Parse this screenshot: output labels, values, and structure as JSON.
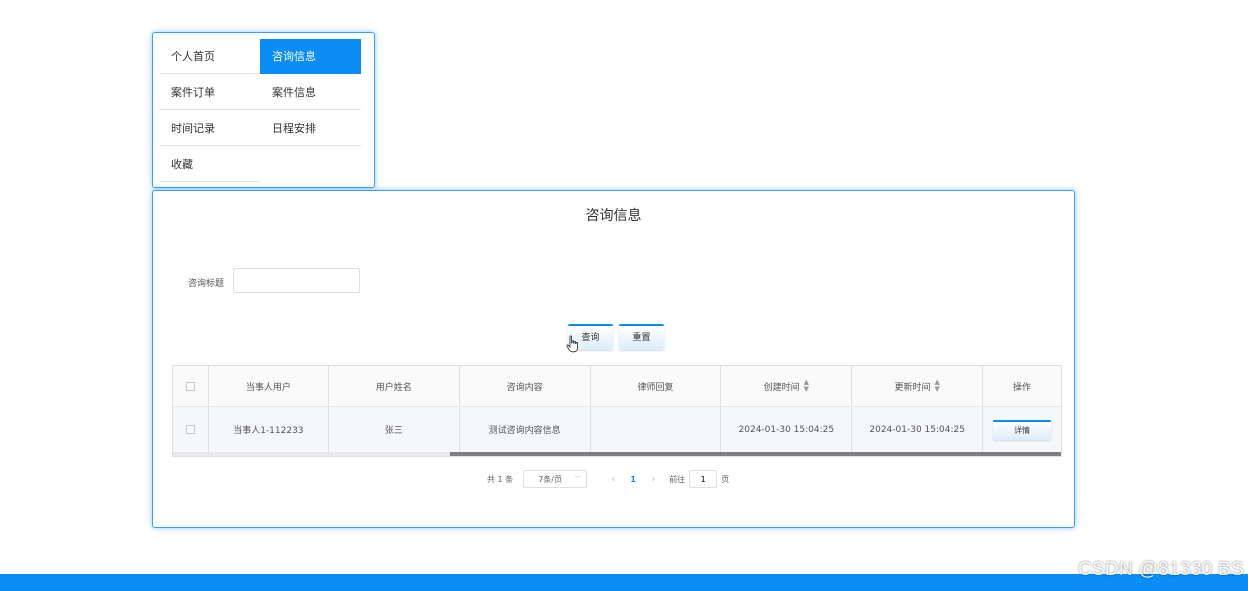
{
  "menu": {
    "items": [
      {
        "label": "个人首页",
        "active": false
      },
      {
        "label": "咨询信息",
        "active": true
      },
      {
        "label": "案件订单",
        "active": false
      },
      {
        "label": "案件信息",
        "active": false
      },
      {
        "label": "时间记录",
        "active": false
      },
      {
        "label": "日程安排",
        "active": false
      },
      {
        "label": "收藏",
        "active": false
      }
    ]
  },
  "panel": {
    "title": "咨询信息",
    "filter": {
      "label": "咨询标题",
      "value": "",
      "placeholder": ""
    },
    "buttons": {
      "query": "查询",
      "reset": "重置"
    }
  },
  "table": {
    "columns": [
      "当事人用户",
      "用户姓名",
      "咨询内容",
      "律师回复",
      "创建时间",
      "更新时间",
      "操作"
    ],
    "rows": [
      {
        "client_user": "当事人1-112233",
        "user_name": "张三",
        "content": "测试咨询内容信息",
        "lawyer_reply": "",
        "created_at": "2024-01-30 15:04:25",
        "updated_at": "2024-01-30 15:04:25",
        "action": "详情"
      }
    ]
  },
  "pagination": {
    "total": "共 1 条",
    "page_size": "7条/页",
    "current_page": "1",
    "goto_label": "前往",
    "goto_value": "1",
    "goto_suffix": "页"
  },
  "watermark": "CSDN @81330 BS",
  "colors": {
    "accent": "#0a8ef5",
    "border": "#3aa0f5"
  }
}
